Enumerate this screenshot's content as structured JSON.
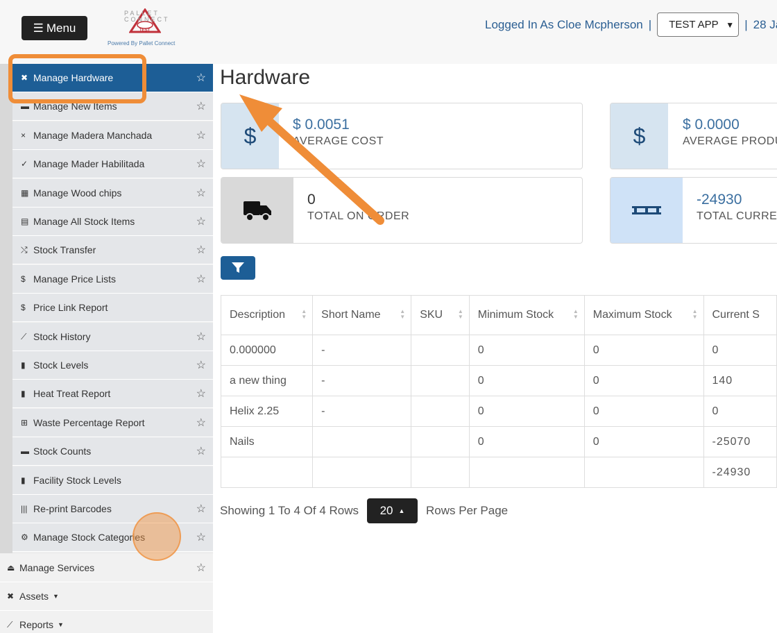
{
  "header": {
    "menu_label": "Menu",
    "logo_letters": "PALLET CONNECT",
    "logo_badge": "TEST",
    "powered_by": "Powered By Pallet Connect",
    "logged_in": "Logged In As Cloe Mcpherson",
    "separator": "|",
    "app_select": "TEST APP",
    "date": "28 Ja"
  },
  "sidebar": {
    "items": [
      {
        "icon": "✖",
        "label": "Manage Hardware",
        "star": true,
        "active": true
      },
      {
        "icon": "▬",
        "label": "Manage New Items",
        "star": true
      },
      {
        "icon": "×",
        "label": "Manage Madera Manchada",
        "star": true
      },
      {
        "icon": "✓",
        "label": "Manage Mader Habilitada",
        "star": true
      },
      {
        "icon": "▦",
        "label": "Manage Wood chips",
        "star": true
      },
      {
        "icon": "▤",
        "label": "Manage All Stock Items",
        "star": true
      },
      {
        "icon": "⤭",
        "label": "Stock Transfer",
        "star": true
      },
      {
        "icon": "$",
        "label": "Manage Price Lists",
        "star": true
      },
      {
        "icon": "$",
        "label": "Price Link Report",
        "star": false
      },
      {
        "icon": "⟋",
        "label": "Stock History",
        "star": true
      },
      {
        "icon": "▮",
        "label": "Stock Levels",
        "star": true
      },
      {
        "icon": "▮",
        "label": "Heat Treat Report",
        "star": true
      },
      {
        "icon": "⊞",
        "label": "Waste Percentage Report",
        "star": true
      },
      {
        "icon": "▬",
        "label": "Stock Counts",
        "star": true
      },
      {
        "icon": "▮",
        "label": "Facility Stock Levels",
        "star": false
      },
      {
        "icon": "|||",
        "label": "Re-print Barcodes",
        "star": true
      },
      {
        "icon": "⚙",
        "label": "Manage Stock Categories",
        "star": true
      }
    ],
    "top_items": [
      {
        "icon": "⏏",
        "label": "Manage Services",
        "star": true,
        "caret": false
      },
      {
        "icon": "✖",
        "label": "Assets",
        "star": false,
        "caret": true
      },
      {
        "icon": "⟋",
        "label": "Reports",
        "star": false,
        "caret": true
      }
    ]
  },
  "main": {
    "title": "Hardware",
    "cards": [
      {
        "icon": "$",
        "value": "$ 0.0051",
        "label": "AVERAGE COST",
        "icon_bg": "#d6e4f0"
      },
      {
        "icon": "$",
        "value": "$ 0.0000",
        "label": "AVERAGE PRODU",
        "icon_bg": "#d6e4f0"
      },
      {
        "icon": "truck",
        "value": "0",
        "label": "TOTAL ON ORDER",
        "icon_bg": "#d9d9d9"
      },
      {
        "icon": "pallet",
        "value": "-24930",
        "label": "TOTAL CURREN",
        "icon_bg": "#cfe2f7"
      }
    ],
    "table": {
      "columns": [
        "Description",
        "Short Name",
        "SKU",
        "Minimum Stock",
        "Maximum Stock",
        "Current S"
      ],
      "rows": [
        [
          "0.000000",
          "-",
          "",
          "0",
          "0",
          "0"
        ],
        [
          "a new thing",
          "-",
          "",
          "0",
          "0",
          "140"
        ],
        [
          "Helix 2.25",
          "-",
          "",
          "0",
          "0",
          "0"
        ],
        [
          "Nails",
          "",
          "",
          "0",
          "0",
          "-25070"
        ],
        [
          "",
          "",
          "",
          "",
          "",
          "-24930"
        ]
      ]
    },
    "pager": {
      "showing": "Showing 1 To 4 Of 4 Rows",
      "page_size": "20",
      "per_page": "Rows Per Page"
    }
  },
  "colors": {
    "accent": "#1d5e96",
    "annotation": "#ef8d38"
  }
}
